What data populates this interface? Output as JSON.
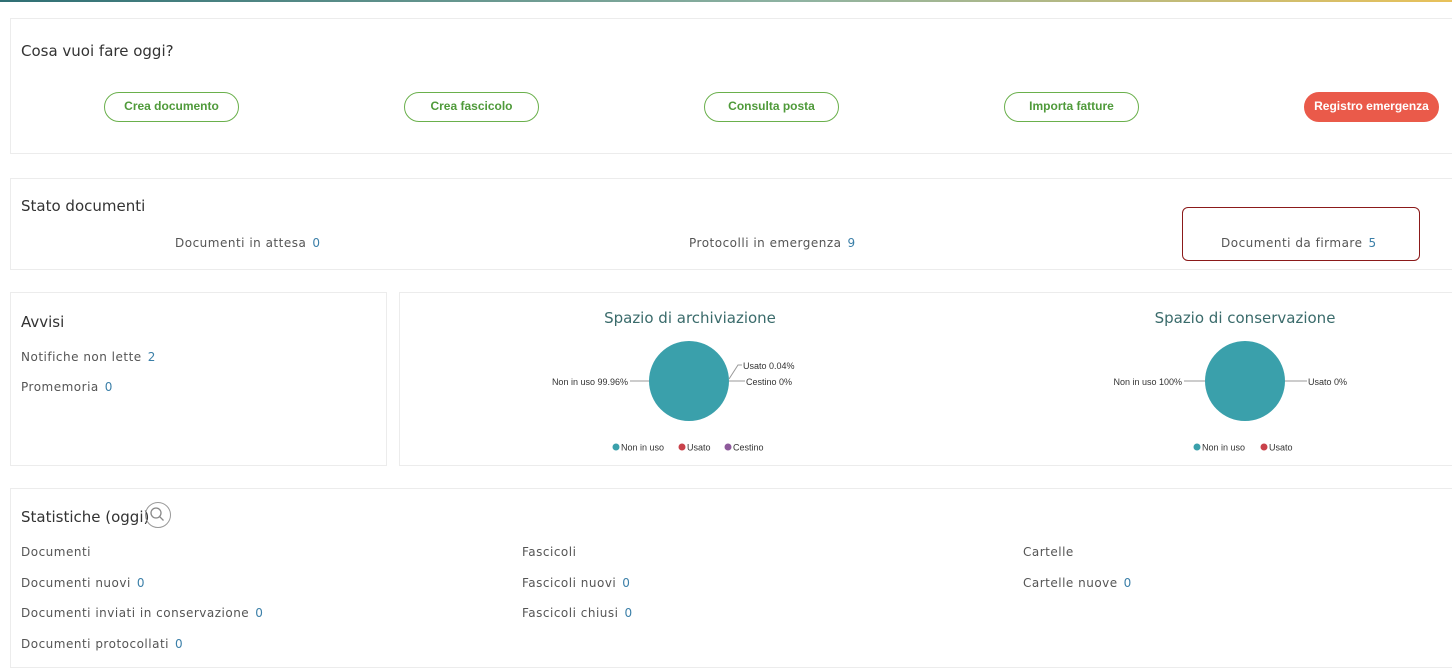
{
  "actions": {
    "title": "Cosa vuoi fare oggi?",
    "buttons": [
      "Crea documento",
      "Crea fascicolo",
      "Consulta posta",
      "Importa fatture",
      "Registro emergenza"
    ]
  },
  "stato": {
    "title": "Stato documenti",
    "items": [
      {
        "label": "Documenti in attesa",
        "value": "0"
      },
      {
        "label": "Protocolli in emergenza",
        "value": "9"
      },
      {
        "label": "Documenti da firmare",
        "value": "5"
      }
    ]
  },
  "avvisi": {
    "title": "Avvisi",
    "items": [
      {
        "label": "Notifiche non lette",
        "value": "2"
      },
      {
        "label": "Promemoria",
        "value": "0"
      }
    ]
  },
  "archiviazione": {
    "title": "Spazio di archiviazione",
    "left_label": "Non in uso 99.96%",
    "right_labels": [
      "Usato 0.04%",
      "Cestino 0%"
    ],
    "legend": [
      "Non in uso",
      "Usato",
      "Cestino"
    ]
  },
  "conservazione": {
    "title": "Spazio di conservazione",
    "left_label": "Non in uso 100%",
    "right_labels": [
      "Usato 0%"
    ],
    "legend": [
      "Non in uso",
      "Usato"
    ]
  },
  "colors": {
    "teal": "#3aa0ab",
    "red": "#c9414a",
    "purple": "#8e5a9b",
    "accent_green": "#6ab04c",
    "emergency": "#ea5a4a"
  },
  "chart_data": [
    {
      "type": "pie",
      "title": "Spazio di archiviazione",
      "categories": [
        "Non in uso",
        "Usato",
        "Cestino"
      ],
      "values": [
        99.96,
        0.04,
        0
      ]
    },
    {
      "type": "pie",
      "title": "Spazio di conservazione",
      "categories": [
        "Non in uso",
        "Usato"
      ],
      "values": [
        100,
        0
      ]
    }
  ],
  "statistiche": {
    "title": "Statistiche (oggi)",
    "search_icon": "search-icon",
    "columns": [
      {
        "heading": "Documenti",
        "rows": [
          {
            "label": "Documenti nuovi",
            "value": "0"
          },
          {
            "label": "Documenti inviati in conservazione",
            "value": "0"
          },
          {
            "label": "Documenti protocollati",
            "value": "0"
          }
        ]
      },
      {
        "heading": "Fascicoli",
        "rows": [
          {
            "label": "Fascicoli nuovi",
            "value": "0"
          },
          {
            "label": "Fascicoli chiusi",
            "value": "0"
          }
        ]
      },
      {
        "heading": "Cartelle",
        "rows": [
          {
            "label": "Cartelle nuove",
            "value": "0"
          }
        ]
      }
    ]
  }
}
